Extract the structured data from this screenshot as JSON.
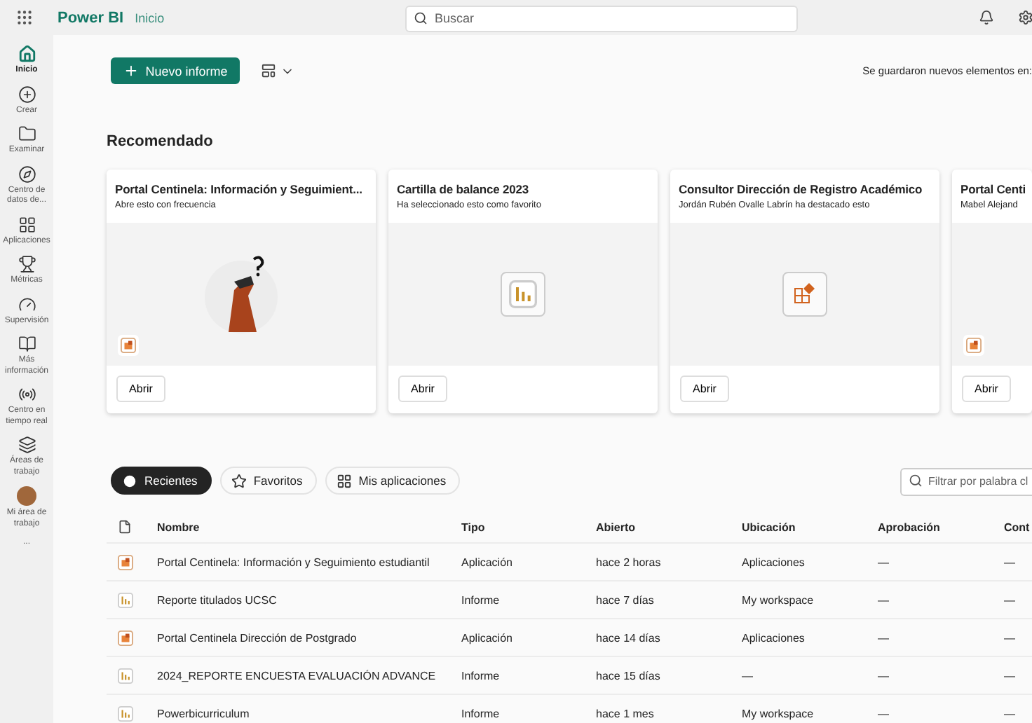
{
  "app": {
    "name": "Power BI",
    "breadcrumb": "Inicio"
  },
  "search": {
    "placeholder": "Buscar"
  },
  "sidebar": {
    "items": [
      {
        "label": "Inicio",
        "kind": "home",
        "selected": true
      },
      {
        "label": "Crear",
        "kind": "create",
        "selected": false
      },
      {
        "label": "Examinar",
        "kind": "browse",
        "selected": false
      },
      {
        "label": "Centro de datos de...",
        "kind": "datahub",
        "selected": false
      },
      {
        "label": "Aplicaciones",
        "kind": "apps",
        "selected": false
      },
      {
        "label": "Métricas",
        "kind": "metrics",
        "selected": false
      },
      {
        "label": "Supervisión",
        "kind": "monitor",
        "selected": false
      },
      {
        "label": "Más información",
        "kind": "learn",
        "selected": false
      },
      {
        "label": "Centro en tiempo real",
        "kind": "realtime",
        "selected": false
      },
      {
        "label": "Áreas de trabajo",
        "kind": "workspaces",
        "selected": false
      },
      {
        "label": "Mi área de trabajo",
        "kind": "avatar",
        "selected": false
      },
      {
        "label": "...",
        "kind": "more",
        "selected": false
      }
    ]
  },
  "toolbar": {
    "new_button": "Nuevo informe",
    "saved_note": "Se guardaron nuevos elementos en:"
  },
  "recommended": {
    "title": "Recomendado",
    "cards": [
      {
        "title": "Portal Centinela: Información y Seguimient...",
        "subtitle": "Abre esto con frecuencia",
        "kind": "app-illustrated",
        "button": "Abrir"
      },
      {
        "title": "Cartilla de balance 2023",
        "subtitle": "Ha seleccionado esto como favorito",
        "kind": "report",
        "button": "Abrir"
      },
      {
        "title": "Consultor Dirección de Registro Académico",
        "subtitle": "Jordán Rubén Ovalle Labrín ha destacado esto",
        "kind": "scorecard",
        "button": "Abrir"
      },
      {
        "title": "Portal Centi",
        "subtitle": "Mabel Alejand",
        "kind": "app",
        "button": "Abrir"
      }
    ]
  },
  "tabs": [
    {
      "label": "Recientes",
      "kind": "recent",
      "selected": true
    },
    {
      "label": "Favoritos",
      "kind": "favorites",
      "selected": false
    },
    {
      "label": "Mis aplicaciones",
      "kind": "apps",
      "selected": false
    }
  ],
  "filter": {
    "placeholder": "Filtrar por palabra cl"
  },
  "table": {
    "columns": [
      "Nombre",
      "Tipo",
      "Abierto",
      "Ubicación",
      "Aprobación",
      "Cont"
    ],
    "rows": [
      {
        "kind": "app",
        "cells": [
          "Portal Centinela: Información y Seguimiento estudiantil",
          "Aplicación",
          "hace 2 horas",
          "Aplicaciones",
          "—",
          "—"
        ]
      },
      {
        "kind": "report",
        "cells": [
          "Reporte titulados UCSC",
          "Informe",
          "hace 7 días",
          "My workspace",
          "—",
          "—"
        ]
      },
      {
        "kind": "app",
        "cells": [
          "Portal Centinela Dirección de Postgrado",
          "Aplicación",
          "hace 14 días",
          "Aplicaciones",
          "—",
          "—"
        ]
      },
      {
        "kind": "report",
        "cells": [
          "2024_REPORTE ENCUESTA EVALUACIÓN ADVANCE",
          "Informe",
          "hace 15 días",
          "—",
          "—",
          "—"
        ]
      },
      {
        "kind": "report",
        "cells": [
          "Powerbicurriculum",
          "Informe",
          "hace 1 mes",
          "My workspace",
          "—",
          "—"
        ]
      }
    ]
  }
}
